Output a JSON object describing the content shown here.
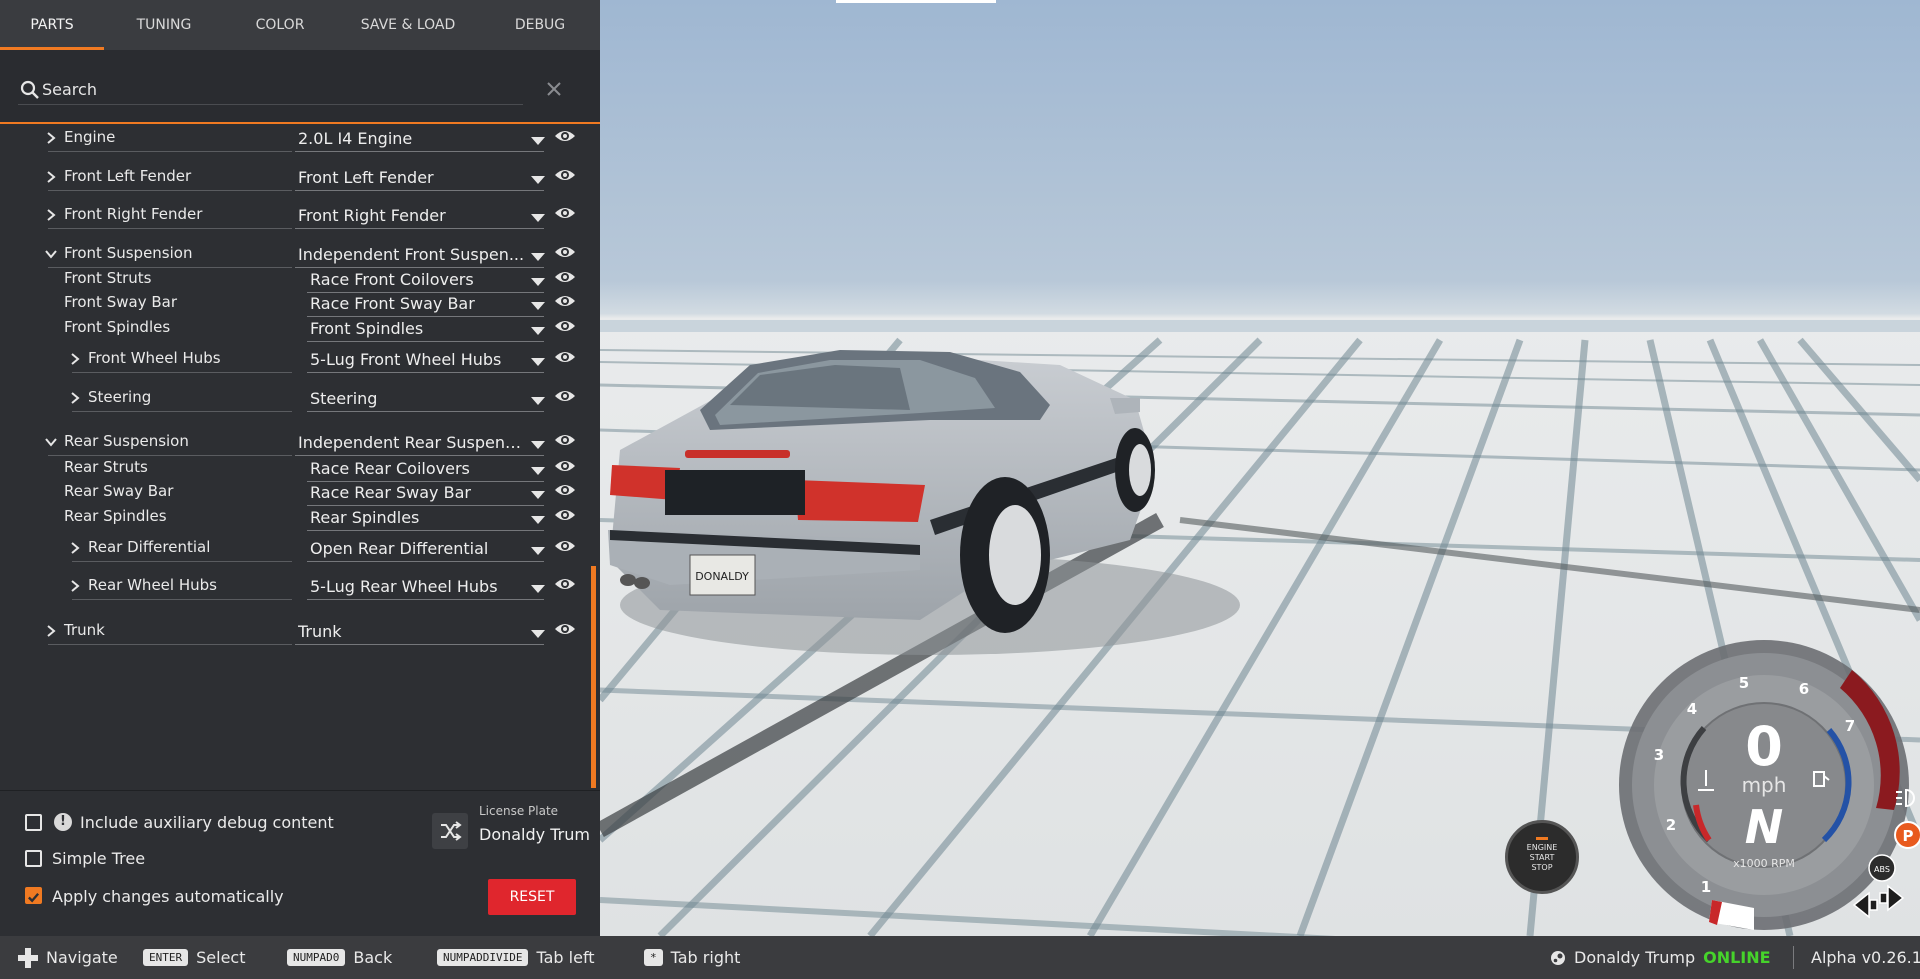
{
  "tabs": [
    {
      "label": "PARTS",
      "active": true
    },
    {
      "label": "TUNING",
      "active": false
    },
    {
      "label": "COLOR",
      "active": false
    },
    {
      "label": "SAVE & LOAD",
      "active": false
    },
    {
      "label": "DEBUG",
      "active": false
    }
  ],
  "search": {
    "placeholder": "Search",
    "value": ""
  },
  "tree": [
    {
      "label": "Engine",
      "value": "2.0L I4 Engine",
      "expander": "collapsed"
    },
    {
      "label": "Front Left Fender",
      "value": "Front Left Fender",
      "expander": "collapsed"
    },
    {
      "label": "Front Right Fender",
      "value": "Front Right Fender",
      "expander": "collapsed"
    },
    {
      "label": "Front Suspension",
      "value": "Independent Front Suspen...",
      "expander": "expanded"
    },
    {
      "label": "Front Struts",
      "value": "Race Front Coilovers",
      "expander": "none"
    },
    {
      "label": "Front Sway Bar",
      "value": "Race Front Sway Bar",
      "expander": "none"
    },
    {
      "label": "Front Spindles",
      "value": "Front Spindles",
      "expander": "none"
    },
    {
      "label": "Front Wheel Hubs",
      "value": "5-Lug Front Wheel Hubs",
      "expander": "collapsed"
    },
    {
      "label": "Steering",
      "value": "Steering",
      "expander": "collapsed"
    },
    {
      "label": "Rear Suspension",
      "value": "Independent Rear Suspensi...",
      "expander": "expanded"
    },
    {
      "label": "Rear Struts",
      "value": "Race Rear Coilovers",
      "expander": "none"
    },
    {
      "label": "Rear Sway Bar",
      "value": "Race Rear Sway Bar",
      "expander": "none"
    },
    {
      "label": "Rear Spindles",
      "value": "Rear Spindles",
      "expander": "none"
    },
    {
      "label": "Rear Differential",
      "value": "Open Rear Differential",
      "expander": "collapsed"
    },
    {
      "label": "Rear Wheel Hubs",
      "value": "5-Lug Rear Wheel Hubs",
      "expander": "collapsed"
    },
    {
      "label": "Trunk",
      "value": "Trunk",
      "expander": "collapsed"
    }
  ],
  "options": {
    "include_debug": {
      "label": "Include auxiliary debug content",
      "checked": false
    },
    "simple_tree": {
      "label": "Simple Tree",
      "checked": false
    },
    "apply_auto": {
      "label": "Apply changes automatically",
      "checked": true
    }
  },
  "license_plate": {
    "caption": "License Plate",
    "value": "Donaldy Trum",
    "plate_text": "DONALDY"
  },
  "reset_label": "RESET",
  "footer": {
    "navigate": "Navigate",
    "select_key": "ENTER",
    "select": "Select",
    "back_key": "NUMPAD0",
    "back": "Back",
    "tab_left_key": "NUMPADDIVIDE",
    "tab_left": "Tab left",
    "tab_right_key": "*",
    "tab_right": "Tab right",
    "user": "Donaldy Trump",
    "status": "ONLINE",
    "version": "Alpha v0.26.1"
  },
  "dashboard": {
    "speed": "0",
    "speed_unit": "mph",
    "gear": "N",
    "rpm_unit": "x1000 RPM",
    "rpm_ticks": [
      "1",
      "2",
      "3",
      "4",
      "5",
      "6",
      "7"
    ],
    "park_label": "P",
    "abs_label": "ABS",
    "engine_button": [
      "ENGINE",
      "START",
      "STOP"
    ]
  },
  "colors": {
    "accent": "#f07a22",
    "reset": "#e0262d",
    "online": "#46d32b",
    "redline": "#8b1a1f"
  }
}
